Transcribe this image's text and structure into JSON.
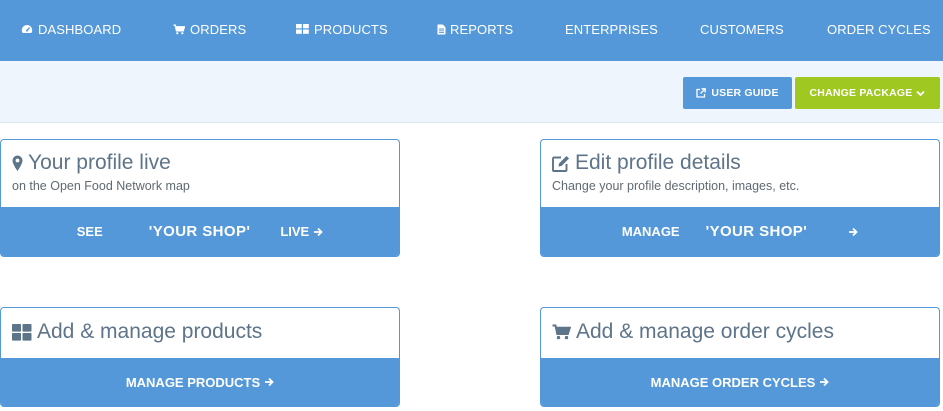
{
  "nav": {
    "items": [
      {
        "label": "DASHBOARD",
        "icon": "dashboard-icon"
      },
      {
        "label": "ORDERS",
        "icon": "cart-icon"
      },
      {
        "label": "PRODUCTS",
        "icon": "grid-icon"
      },
      {
        "label": "REPORTS",
        "icon": "file-icon"
      },
      {
        "label": "ENTERPRISES",
        "icon": ""
      },
      {
        "label": "CUSTOMERS",
        "icon": ""
      },
      {
        "label": "ORDER CYCLES",
        "icon": ""
      }
    ]
  },
  "toolbar": {
    "user_guide_label": "USER GUIDE",
    "change_package_label": "CHANGE PACKAGE"
  },
  "panels": {
    "profile_live": {
      "title": "Your profile live",
      "subtitle": "on the Open Food Network map",
      "action_prefix": "SEE",
      "shop_name": "'YOUR SHOP'",
      "action_suffix": "LIVE"
    },
    "edit_profile": {
      "title": "Edit profile details",
      "subtitle": "Change your profile description, images, etc.",
      "action_prefix": "MANAGE",
      "shop_name": "'YOUR SHOP'"
    },
    "products": {
      "title": "Add & manage products",
      "action_label": "MANAGE PRODUCTS"
    },
    "order_cycles": {
      "title": "Add & manage order cycles",
      "action_label": "MANAGE ORDER CYCLES"
    }
  },
  "colors": {
    "primary": "#5498da",
    "accent_green": "#9fc820",
    "title_text": "#5e7489",
    "actionbar_bg": "#eff5fc"
  }
}
